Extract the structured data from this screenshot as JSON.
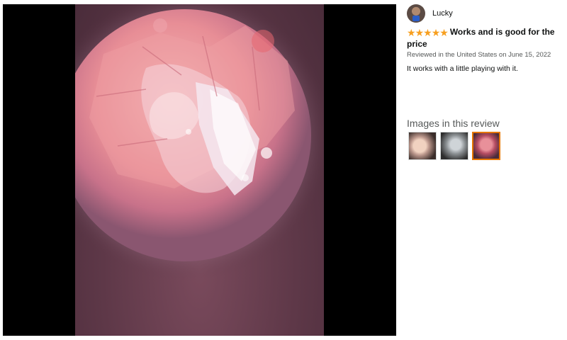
{
  "viewer": {
    "image_icon": "ear-canal-photo"
  },
  "review": {
    "reviewer_name": "Lucky",
    "rating": 5,
    "rating_max": 5,
    "star_glyph": "★",
    "star_color": "#f79f1f",
    "title": "Works and is good for the price",
    "meta": "Reviewed in the United States on June 15, 2022",
    "body": "It works with a little playing with it."
  },
  "images_section": {
    "heading": "Images in this review",
    "thumbnails": [
      {
        "icon": "ear-photo-thumbnail",
        "selected": false
      },
      {
        "icon": "ear-photo-thumbnail",
        "selected": false
      },
      {
        "icon": "ear-photo-thumbnail",
        "selected": true
      }
    ],
    "selected_border_color": "#e77600"
  }
}
